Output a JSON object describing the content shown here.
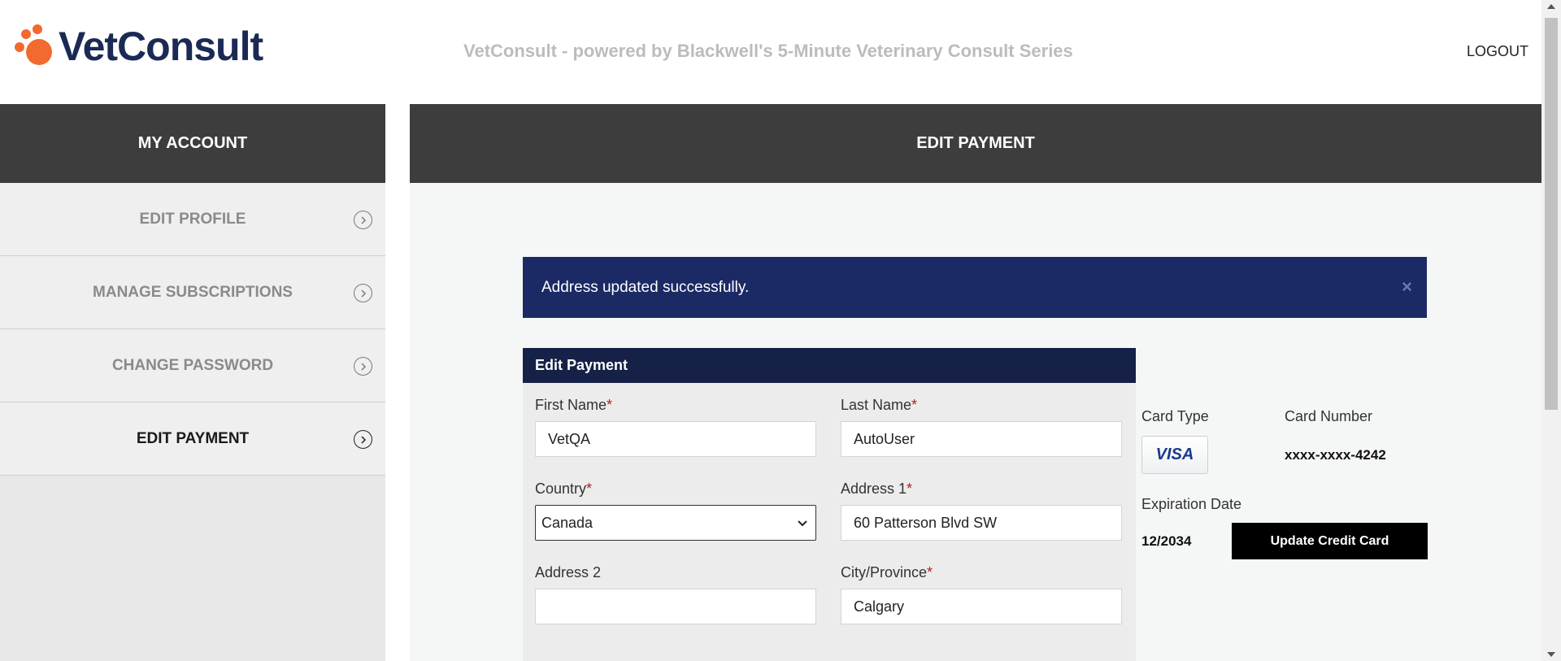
{
  "header": {
    "logo_text": "VetConsult",
    "tagline": "VetConsult - powered by Blackwell's 5-Minute Veterinary Consult Series",
    "logout_label": "LOGOUT"
  },
  "sidebar": {
    "title": "MY ACCOUNT",
    "items": [
      {
        "label": "EDIT PROFILE"
      },
      {
        "label": "MANAGE SUBSCRIPTIONS"
      },
      {
        "label": "CHANGE PASSWORD"
      },
      {
        "label": "EDIT PAYMENT"
      }
    ]
  },
  "main": {
    "title": "EDIT PAYMENT",
    "alert": {
      "message": "Address updated successfully.",
      "close_glyph": "×"
    },
    "form": {
      "title": "Edit Payment",
      "first_name": {
        "label": "First Name",
        "value": "VetQA"
      },
      "last_name": {
        "label": "Last Name",
        "value": "AutoUser"
      },
      "country": {
        "label": "Country",
        "value": "Canada"
      },
      "address1": {
        "label": "Address 1",
        "value": "60 Patterson Blvd SW"
      },
      "address2": {
        "label": "Address 2",
        "value": ""
      },
      "city": {
        "label": "City/Province",
        "value": "Calgary"
      },
      "required_mark": "*"
    },
    "card": {
      "type_label": "Card Type",
      "type_value": "VISA",
      "number_label": "Card Number",
      "number_value": "xxxx-xxxx-4242",
      "expiration_label": "Expiration Date",
      "expiration_value": "12/2034",
      "update_button": "Update Credit Card"
    }
  },
  "colors": {
    "brand_orange": "#f26a2e",
    "brand_navy": "#1b2a54",
    "alert_bg": "#1b2a64",
    "header_bar": "#3d3d3d"
  }
}
